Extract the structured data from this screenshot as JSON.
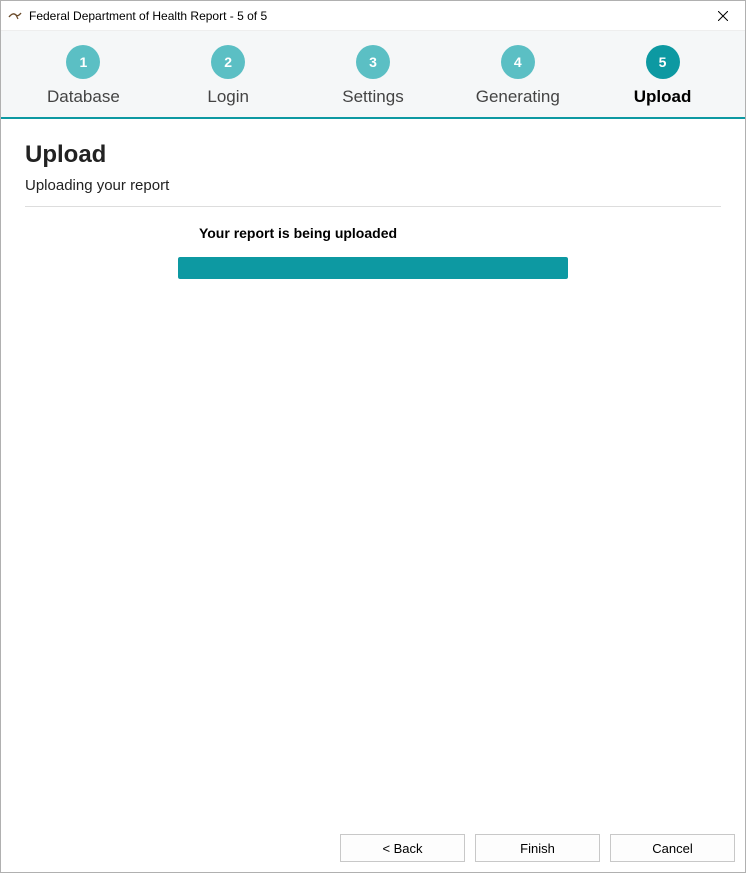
{
  "window": {
    "title": "Federal Department of Health Report - 5 of 5",
    "icon_name": "app-icon"
  },
  "stepper": {
    "steps": [
      {
        "num": "1",
        "label": "Database",
        "active": false
      },
      {
        "num": "2",
        "label": "Login",
        "active": false
      },
      {
        "num": "3",
        "label": "Settings",
        "active": false
      },
      {
        "num": "4",
        "label": "Generating",
        "active": false
      },
      {
        "num": "5",
        "label": "Upload",
        "active": true
      }
    ]
  },
  "page": {
    "title": "Upload",
    "subtitle": "Uploading your report",
    "upload_message": "Your report is being uploaded",
    "progress_percent": 100
  },
  "footer": {
    "back_label": "< Back",
    "finish_label": "Finish",
    "cancel_label": "Cancel"
  },
  "colors": {
    "accent": "#0d99a2",
    "accent_light": "#5bbfc4"
  }
}
